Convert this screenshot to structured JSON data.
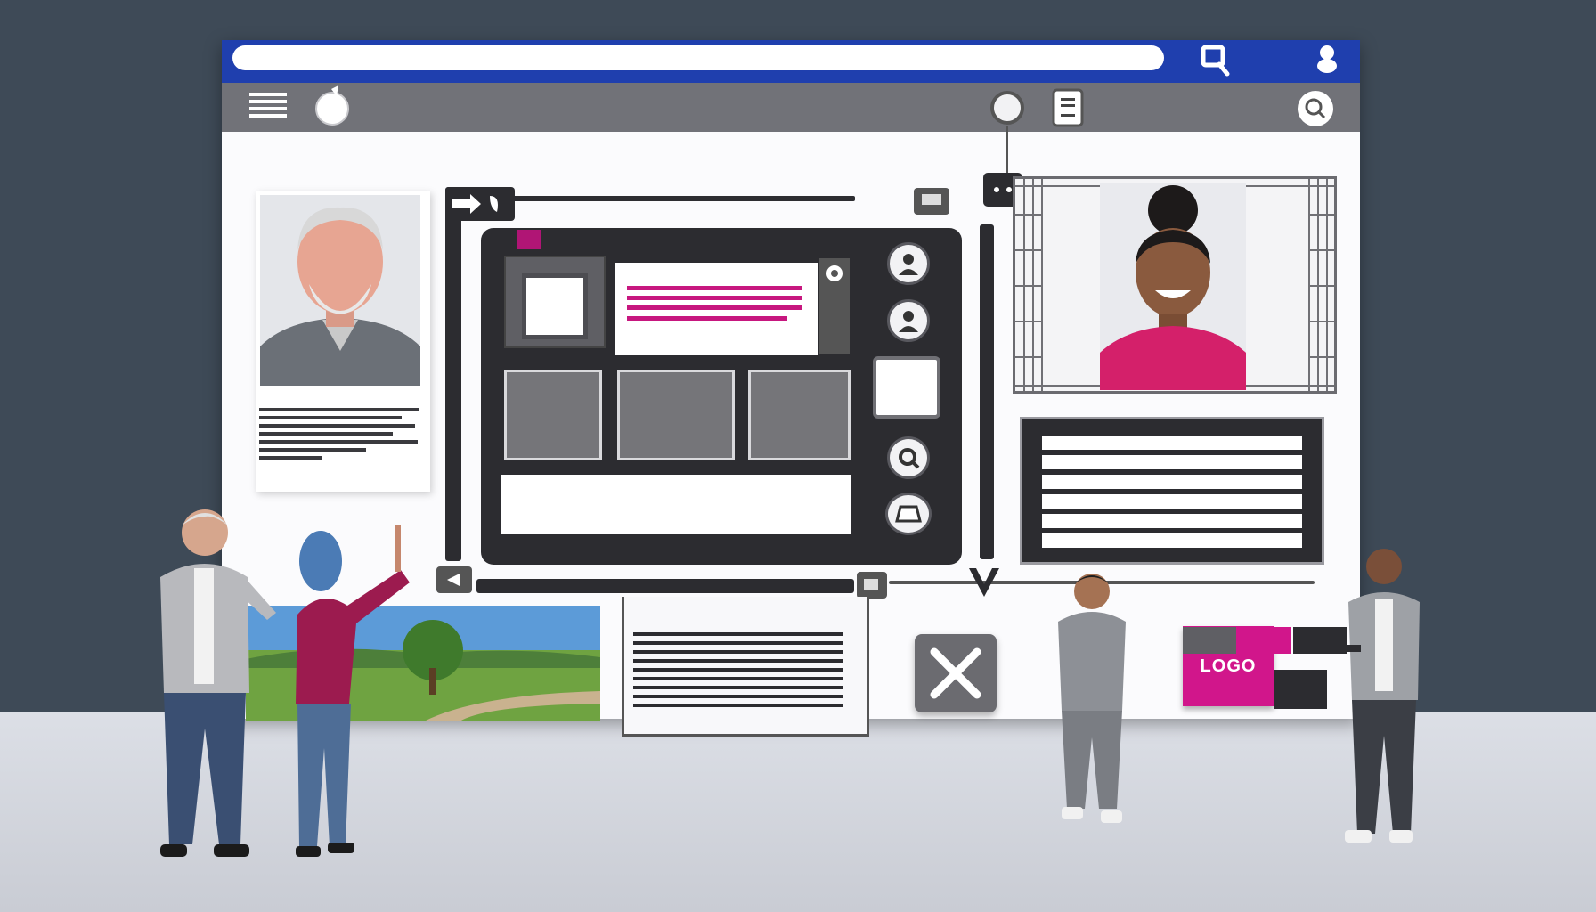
{
  "colors": {
    "background": "#3e4a57",
    "top_bar": "#1f3fae",
    "toolbar": "#717278",
    "panel_dark": "#2c2c30",
    "accent_magenta": "#c7177f",
    "tile_gray": "#757579"
  },
  "icons": {
    "toolbar_left": [
      "menu-icon",
      "chat-bubble-icon"
    ],
    "toolbar_right": [
      "circle-icon",
      "document-icon",
      "search-icon"
    ],
    "top_bar": [
      "search-icon",
      "user-icon"
    ],
    "side_buttons": [
      "user-icon",
      "user-icon",
      "square-icon",
      "search-icon",
      "trapezoid-icon"
    ]
  },
  "logo": {
    "label": "LOGO"
  }
}
